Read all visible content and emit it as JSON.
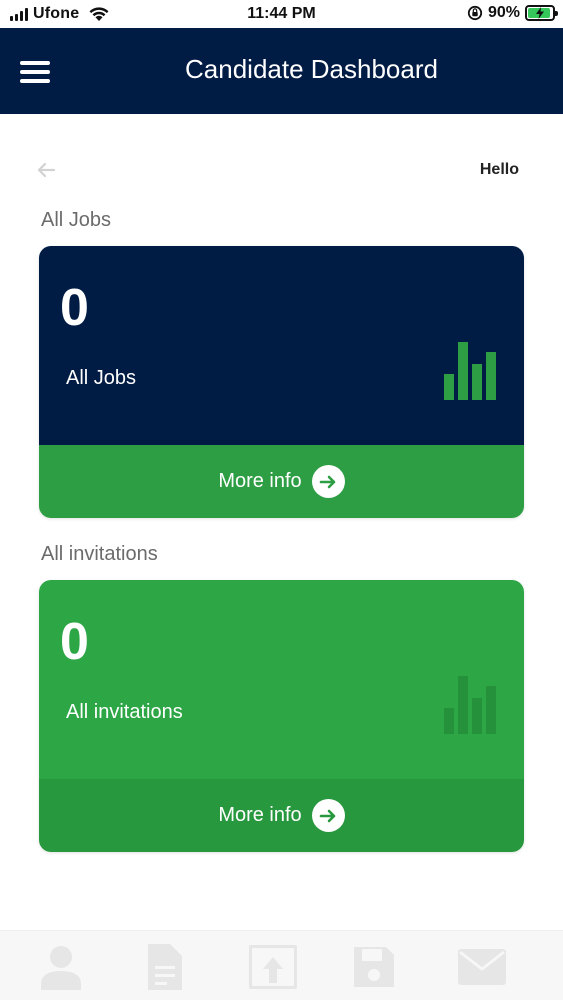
{
  "status_bar": {
    "carrier": "Ufone",
    "time": "11:44 PM",
    "battery_percent": "90%",
    "battery_level": 0.9
  },
  "header": {
    "title": "Candidate Dashboard"
  },
  "subheader": {
    "greeting": "Hello"
  },
  "sections": [
    {
      "heading": "All Jobs",
      "count": "0",
      "label": "All Jobs",
      "more_label": "More info",
      "colors": {
        "top": "#001b44",
        "footer": "#2e9e44",
        "chart": "#2e9e44"
      }
    },
    {
      "heading": "All invitations",
      "count": "0",
      "label": "All invitations",
      "more_label": "More info",
      "colors": {
        "top": "#2da646",
        "footer": "#28983f",
        "chart": "#25913b"
      }
    }
  ],
  "bottom_nav": {
    "items": [
      "user-icon",
      "document-icon",
      "upload-icon",
      "save-icon",
      "mail-icon"
    ],
    "icon_color": "#e6e6e6"
  },
  "colors": {
    "brand_navy": "#001b44",
    "brand_green": "#2e9e44",
    "section_heading": "#6b6b6b"
  }
}
